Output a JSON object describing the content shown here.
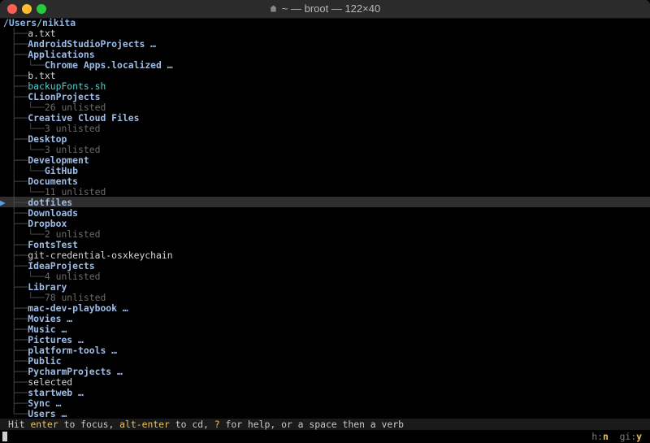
{
  "window": {
    "title": "~ — broot — 122×40"
  },
  "root_path": "/Users/nikita",
  "tree": [
    {
      "branch": "├──",
      "name": "a.txt",
      "kind": "file"
    },
    {
      "branch": "├──",
      "name": "AndroidStudioProjects …",
      "kind": "dir"
    },
    {
      "branch": "├──",
      "name": "Applications",
      "kind": "dir"
    },
    {
      "branch": "│  └──",
      "name": "Chrome Apps.localized …",
      "kind": "dir"
    },
    {
      "branch": "├──",
      "name": "b.txt",
      "kind": "file"
    },
    {
      "branch": "├──",
      "name": "backupFonts.sh",
      "kind": "exe"
    },
    {
      "branch": "├──",
      "name": "CLionProjects",
      "kind": "dir"
    },
    {
      "branch": "│  └──",
      "name": "26 unlisted",
      "kind": "meta"
    },
    {
      "branch": "├──",
      "name": "Creative Cloud Files",
      "kind": "dir"
    },
    {
      "branch": "│  └──",
      "name": "3 unlisted",
      "kind": "meta"
    },
    {
      "branch": "├──",
      "name": "Desktop",
      "kind": "dir"
    },
    {
      "branch": "│  └──",
      "name": "3 unlisted",
      "kind": "meta"
    },
    {
      "branch": "├──",
      "name": "Development",
      "kind": "dir"
    },
    {
      "branch": "│  └──",
      "name": "GitHub",
      "kind": "dir"
    },
    {
      "branch": "├──",
      "name": "Documents",
      "kind": "dir"
    },
    {
      "branch": "│  └──",
      "name": "11 unlisted",
      "kind": "meta"
    },
    {
      "branch": "├──",
      "name": "dotfiles",
      "kind": "dir",
      "selected": true
    },
    {
      "branch": "├──",
      "name": "Downloads",
      "kind": "dir"
    },
    {
      "branch": "├──",
      "name": "Dropbox",
      "kind": "dir"
    },
    {
      "branch": "│  └──",
      "name": "2 unlisted",
      "kind": "meta"
    },
    {
      "branch": "├──",
      "name": "FontsTest",
      "kind": "dir"
    },
    {
      "branch": "├──",
      "name": "git-credential-osxkeychain",
      "kind": "file"
    },
    {
      "branch": "├──",
      "name": "IdeaProjects",
      "kind": "dir"
    },
    {
      "branch": "│  └──",
      "name": "4 unlisted",
      "kind": "meta"
    },
    {
      "branch": "├──",
      "name": "Library",
      "kind": "dir"
    },
    {
      "branch": "│  └──",
      "name": "78 unlisted",
      "kind": "meta"
    },
    {
      "branch": "├──",
      "name": "mac-dev-playbook …",
      "kind": "dir"
    },
    {
      "branch": "├──",
      "name": "Movies …",
      "kind": "dir"
    },
    {
      "branch": "├──",
      "name": "Music …",
      "kind": "dir"
    },
    {
      "branch": "├──",
      "name": "Pictures …",
      "kind": "dir"
    },
    {
      "branch": "├──",
      "name": "platform-tools …",
      "kind": "dir"
    },
    {
      "branch": "├──",
      "name": "Public",
      "kind": "dir"
    },
    {
      "branch": "├──",
      "name": "PycharmProjects …",
      "kind": "dir"
    },
    {
      "branch": "├──",
      "name": "selected",
      "kind": "file"
    },
    {
      "branch": "├──",
      "name": "startweb …",
      "kind": "dir"
    },
    {
      "branch": "├──",
      "name": "Sync …",
      "kind": "dir"
    },
    {
      "branch": "└──",
      "name": "Users …",
      "kind": "dir"
    }
  ],
  "status": {
    "parts": [
      {
        "text": "Hit ",
        "key": false
      },
      {
        "text": "enter",
        "key": true
      },
      {
        "text": " to focus, ",
        "key": false
      },
      {
        "text": "alt-enter",
        "key": true
      },
      {
        "text": " to cd, ",
        "key": false
      },
      {
        "text": "?",
        "key": true
      },
      {
        "text": " for help, or a space then a verb",
        "key": false
      }
    ]
  },
  "flags": {
    "h_label": "h:",
    "h_value": "n",
    "gi_label": "gi:",
    "gi_value": "y"
  },
  "colors": {
    "accent": "#e9c25b",
    "dir": "#9dbde8",
    "exe": "#4fd1d0",
    "selection": "#2e2e2e"
  },
  "icons": {
    "title_icon": "home-icon",
    "selection_marker": "triangle-right-icon"
  }
}
